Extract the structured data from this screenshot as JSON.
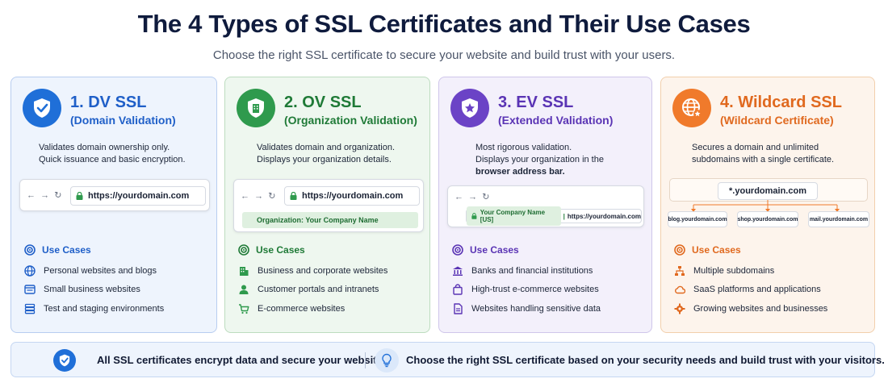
{
  "header": {
    "title": "The 4 Types of SSL Certificates and Their Use Cases",
    "subtitle": "Choose the right SSL certificate to secure your website and build trust with your users."
  },
  "colors": {
    "dv": "#1f6fd8",
    "ov": "#2f9a4d",
    "ev": "#6b43c6",
    "wildcard": "#f07a2b"
  },
  "cards": {
    "dv": {
      "title": "1. DV SSL",
      "subtitle": "(Domain Validation)",
      "icon": "shield-check-icon",
      "desc_lines": [
        "Validates domain ownership only.",
        "Quick issuance and basic encryption."
      ],
      "browser": {
        "url": "https://yourdomain.com"
      },
      "use_cases_label": "Use Cases",
      "use_cases": [
        {
          "icon": "globe-icon",
          "text": "Personal websites and blogs"
        },
        {
          "icon": "browser-window-icon",
          "text": "Small business websites"
        },
        {
          "icon": "server-icon",
          "text": "Test and staging environments"
        }
      ]
    },
    "ov": {
      "title": "2. OV SSL",
      "subtitle": "(Organization Validation)",
      "icon": "building-icon",
      "desc_lines": [
        "Validates domain and organization.",
        "Displays your organization details."
      ],
      "browser": {
        "url": "https://yourdomain.com",
        "org_label": "Organization: Your Company Name"
      },
      "use_cases_label": "Use Cases",
      "use_cases": [
        {
          "icon": "office-building-icon",
          "text": "Business and corporate websites"
        },
        {
          "icon": "user-icon",
          "text": "Customer portals and intranets"
        },
        {
          "icon": "cart-icon",
          "text": "E-commerce websites"
        }
      ]
    },
    "ev": {
      "title": "3. EV SSL",
      "subtitle": "(Extended Validation)",
      "icon": "shield-star-icon",
      "desc_lines": [
        "Most rigorous validation.",
        "Displays your organization in the"
      ],
      "desc_bold": "browser address bar.",
      "browser": {
        "company": "Your Company Name [US]",
        "separator": "|",
        "url": "https://yourdomain.com"
      },
      "use_cases_label": "Use Cases",
      "use_cases": [
        {
          "icon": "bank-icon",
          "text": "Banks and financial institutions"
        },
        {
          "icon": "shopping-bag-icon",
          "text": "High-trust e-commerce websites"
        },
        {
          "icon": "document-icon",
          "text": "Websites handling sensitive data"
        }
      ]
    },
    "wc": {
      "title": "4. Wildcard SSL",
      "subtitle": "(Wildcard Certificate)",
      "icon": "globe-star-icon",
      "desc_lines": [
        "Secures a domain and unlimited",
        "subdomains with a single certificate."
      ],
      "diagram": {
        "main": "*.yourdomain.com",
        "subs": [
          "blog.yourdomain.com",
          "shop.yourdomain.com",
          "mail.yourdomain.com"
        ]
      },
      "use_cases_label": "Use Cases",
      "use_cases": [
        {
          "icon": "hierarchy-icon",
          "text": "Multiple subdomains"
        },
        {
          "icon": "cloud-icon",
          "text": "SaaS platforms and applications"
        },
        {
          "icon": "gear-icon",
          "text": "Growing websites and businesses"
        }
      ]
    }
  },
  "footer": {
    "left_text": "All SSL certificates encrypt data and secure your website.",
    "right_text": "Choose the right SSL certificate based on your security needs and build trust with your visitors."
  }
}
